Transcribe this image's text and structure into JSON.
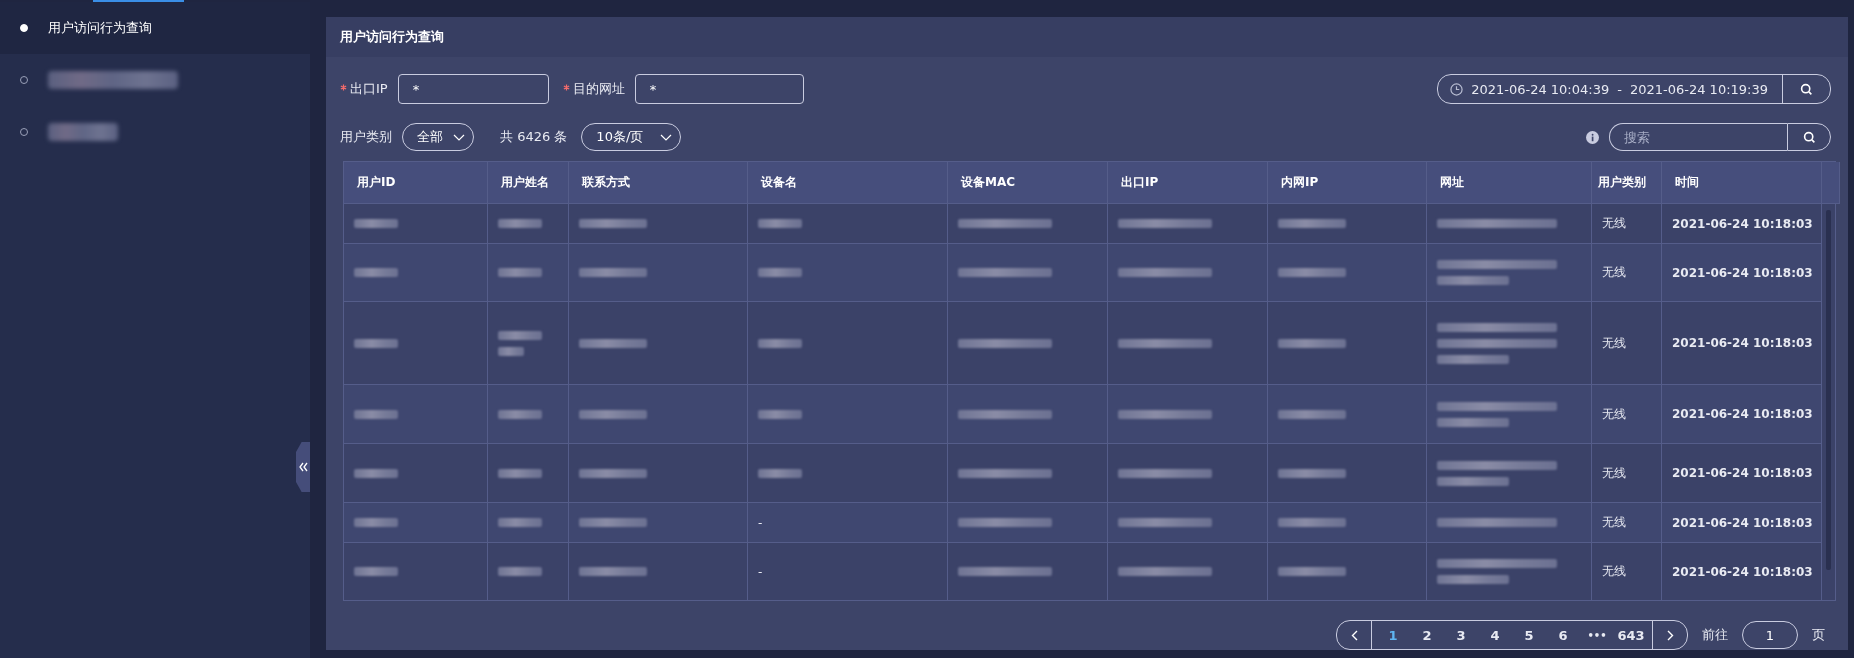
{
  "sidebar": {
    "items": [
      {
        "kind": "text",
        "label": "用户访问行为查询",
        "selected": true
      },
      {
        "kind": "blurred",
        "selected": false
      },
      {
        "kind": "blurred",
        "selected": false
      }
    ]
  },
  "panel": {
    "title": "用户访问行为查询",
    "filters": [
      {
        "label": "出口IP",
        "required": true,
        "value": "*"
      },
      {
        "label": "目的网址",
        "required": true,
        "value": "*"
      }
    ],
    "time_range": {
      "start": "2021-06-24 10:04:39",
      "separator": "-",
      "end": "2021-06-24 10:19:39"
    },
    "user_type": {
      "label": "用户类别",
      "value": "全部"
    },
    "total": "共 6426 条",
    "page_size": "10条/页",
    "search": {
      "placeholder": "搜索"
    }
  },
  "table": {
    "columns": [
      "用户ID",
      "用户姓名",
      "联系方式",
      "设备名",
      "设备MAC",
      "出口IP",
      "内网IP",
      "网址",
      "用户类别",
      "时间"
    ],
    "rows": [
      {
        "cells": [
          {
            "kind": "blur1"
          },
          {
            "kind": "blur1"
          },
          {
            "kind": "blur1"
          },
          {
            "kind": "blur1"
          },
          {
            "kind": "blur1"
          },
          {
            "kind": "blur1"
          },
          {
            "kind": "blur1"
          },
          {
            "kind": "blur1"
          }
        ],
        "user_type": "无线",
        "time": "2021-06-24 10:18:03"
      },
      {
        "cells": [
          {
            "kind": "blur1"
          },
          {
            "kind": "blur1"
          },
          {
            "kind": "blur1"
          },
          {
            "kind": "blur1"
          },
          {
            "kind": "blur1"
          },
          {
            "kind": "blur1"
          },
          {
            "kind": "blur1"
          },
          {
            "kind": "blur2"
          }
        ],
        "user_type": "无线",
        "time": "2021-06-24 10:18:03"
      },
      {
        "cells": [
          {
            "kind": "blur1"
          },
          {
            "kind": "blur2"
          },
          {
            "kind": "blur1"
          },
          {
            "kind": "blur1"
          },
          {
            "kind": "blur1"
          },
          {
            "kind": "blur1"
          },
          {
            "kind": "blur1"
          },
          {
            "kind": "blur3"
          }
        ],
        "user_type": "无线",
        "time": "2021-06-24 10:18:03"
      },
      {
        "cells": [
          {
            "kind": "blur1"
          },
          {
            "kind": "blur1"
          },
          {
            "kind": "blur1"
          },
          {
            "kind": "blur1"
          },
          {
            "kind": "blur1"
          },
          {
            "kind": "blur1"
          },
          {
            "kind": "blur1"
          },
          {
            "kind": "blur2"
          }
        ],
        "user_type": "无线",
        "time": "2021-06-24 10:18:03"
      },
      {
        "cells": [
          {
            "kind": "blur1"
          },
          {
            "kind": "blur1"
          },
          {
            "kind": "blur1"
          },
          {
            "kind": "blur1"
          },
          {
            "kind": "blur1"
          },
          {
            "kind": "blur1"
          },
          {
            "kind": "blur1"
          },
          {
            "kind": "blur2"
          }
        ],
        "user_type": "无线",
        "time": "2021-06-24 10:18:03"
      },
      {
        "cells": [
          {
            "kind": "blur1"
          },
          {
            "kind": "blur1"
          },
          {
            "kind": "blur1"
          },
          {
            "kind": "text",
            "text": "-"
          },
          {
            "kind": "blur1"
          },
          {
            "kind": "blur1"
          },
          {
            "kind": "blur1"
          },
          {
            "kind": "blur1"
          }
        ],
        "user_type": "无线",
        "time": "2021-06-24 10:18:03"
      },
      {
        "cells": [
          {
            "kind": "blur1"
          },
          {
            "kind": "blur1"
          },
          {
            "kind": "blur1"
          },
          {
            "kind": "text",
            "text": "-"
          },
          {
            "kind": "blur1"
          },
          {
            "kind": "blur1"
          },
          {
            "kind": "blur1"
          },
          {
            "kind": "blur2"
          }
        ],
        "user_type": "无线",
        "time": "2021-06-24 10:18:03"
      }
    ]
  },
  "pagination": {
    "pages": [
      {
        "kind": "page",
        "label": "1",
        "selected": true
      },
      {
        "kind": "page",
        "label": "2",
        "selected": false
      },
      {
        "kind": "page",
        "label": "3",
        "selected": false
      },
      {
        "kind": "page",
        "label": "4",
        "selected": false
      },
      {
        "kind": "page",
        "label": "5",
        "selected": false
      },
      {
        "kind": "page",
        "label": "6",
        "selected": false
      },
      {
        "kind": "ellipsis",
        "label": "•••",
        "selected": false
      },
      {
        "kind": "page",
        "label": "643",
        "selected": false
      }
    ],
    "goto_label": "前往",
    "goto_value": "1",
    "goto_suffix": "页"
  }
}
